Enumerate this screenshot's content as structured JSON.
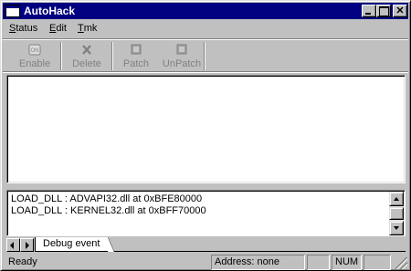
{
  "window": {
    "title": "AutoHack"
  },
  "menu": [
    {
      "pre": "",
      "u": "S",
      "post": "tatus"
    },
    {
      "pre": "",
      "u": "E",
      "post": "dit"
    },
    {
      "pre": "",
      "u": "T",
      "post": "mk"
    }
  ],
  "toolbar": {
    "enable": "Enable",
    "delete": "Delete",
    "patch": "Patch",
    "unpatch": "UnPatch"
  },
  "log": {
    "lines": [
      "LOAD_DLL : ADVAPI32.dll at 0xBFE80000",
      "LOAD_DLL : KERNEL32.dll at 0xBFF70000"
    ]
  },
  "tabs": {
    "active": "Debug event"
  },
  "status": {
    "ready": "Ready",
    "address": "Address: none",
    "empty1": "",
    "num": "NUM",
    "empty2": ""
  }
}
